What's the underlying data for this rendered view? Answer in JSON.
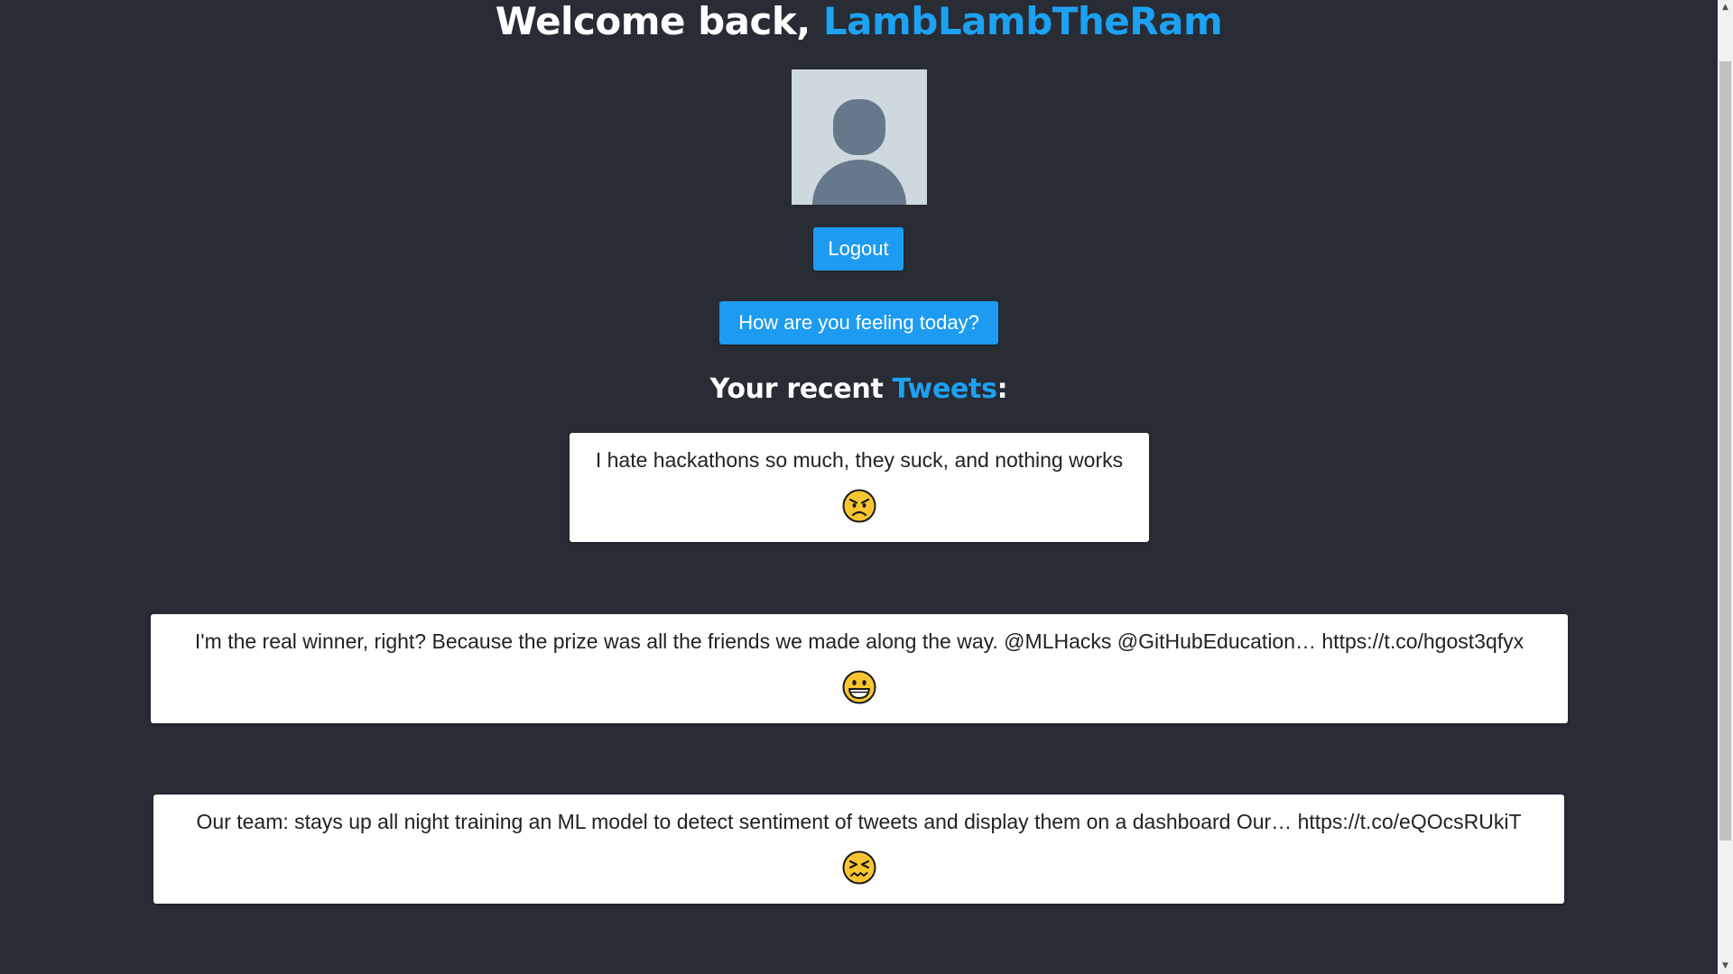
{
  "header": {
    "welcome_prefix": "Welcome back, ",
    "username": "LambLambTheRam"
  },
  "actions": {
    "logout_label": "Logout",
    "mood_label": "How are you feeling today?"
  },
  "recent": {
    "prefix": "Your recent ",
    "accent": "Tweets",
    "suffix": ":"
  },
  "tweets": [
    {
      "text": "I hate hackathons so much, they suck, and nothing works",
      "sentiment_icon": "angry-face-icon"
    },
    {
      "text": "I'm the real winner, right? Because the prize was all the friends we made along the way. @MLHacks @GitHubEducation… https://t.co/hgost3qfyx",
      "sentiment_icon": "grinning-face-icon"
    },
    {
      "text": "Our team: stays up all night training an ML model to detect sentiment of tweets and display them on a dashboard Our… https://t.co/eQOcsRUkiT",
      "sentiment_icon": "confounded-face-icon"
    }
  ],
  "colors": {
    "background": "#282c34",
    "accent": "#1da1f2",
    "button": "#1d9bf0",
    "card": "#ffffff",
    "emoji_yellow": "#f8c531"
  },
  "icons": {
    "avatar": "default-avatar-icon",
    "scroll_up": "scroll-up-arrow-icon",
    "scroll_down": "scroll-down-arrow-icon"
  }
}
